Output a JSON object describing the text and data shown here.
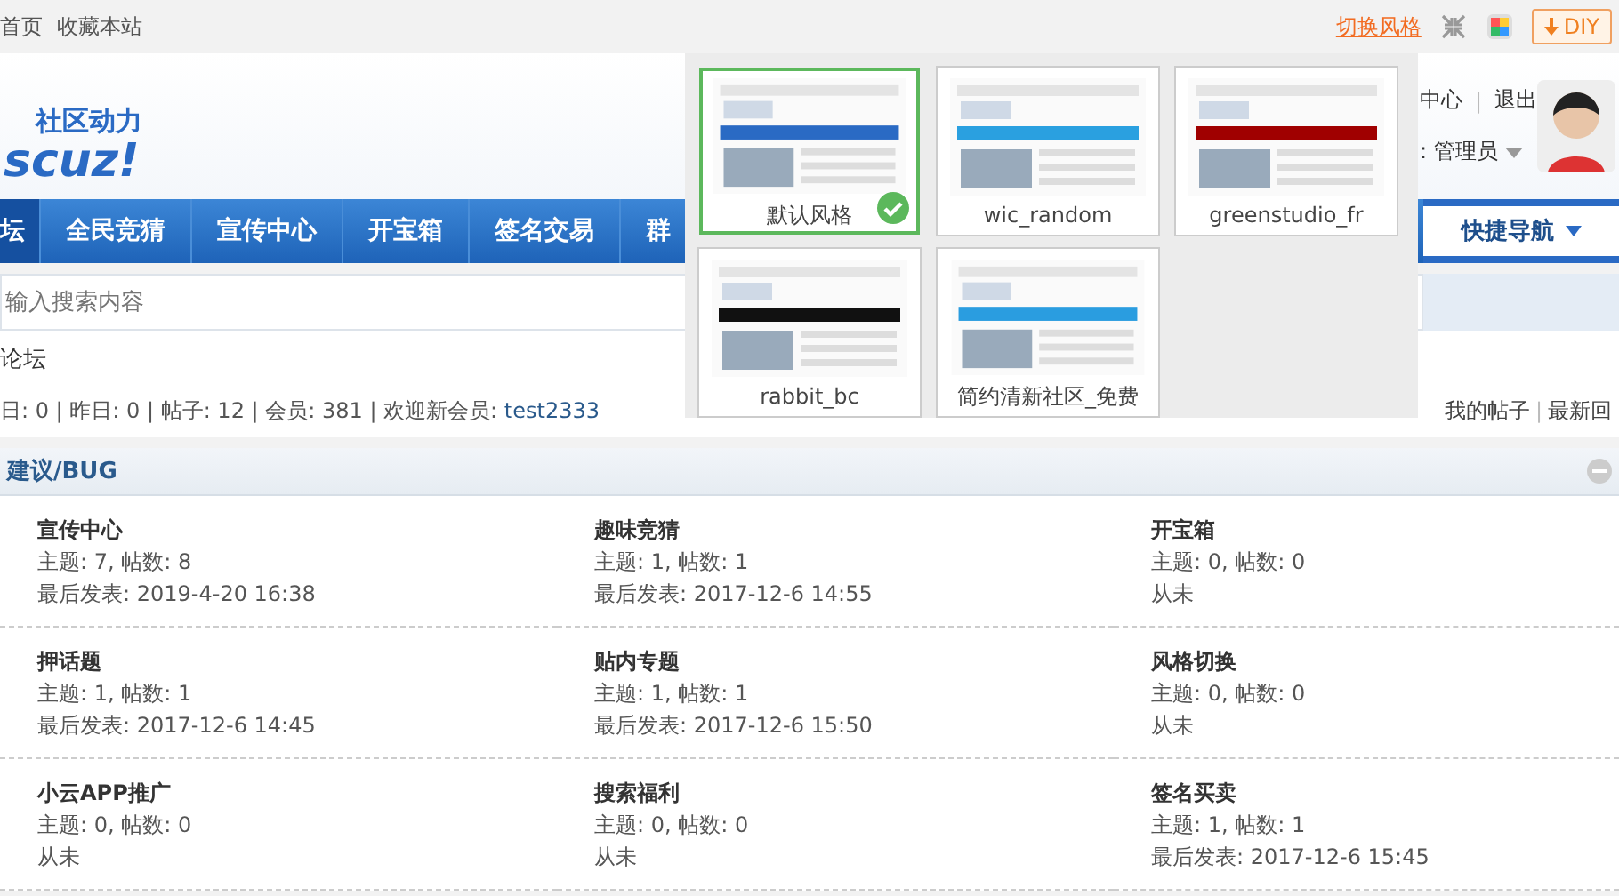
{
  "top_bar": {
    "links": [
      "首页",
      "收藏本站"
    ],
    "style_switch": "切换风格",
    "diy_button": "DIY"
  },
  "header": {
    "logo_tagline": "社区动力",
    "logo_text": "scuz!"
  },
  "separator": "|",
  "user_panel": {
    "links": [
      "中心",
      "退出"
    ],
    "group": ": 管理员"
  },
  "nav": [
    {
      "label": "坛",
      "selected": true
    },
    {
      "label": "全民竞猜",
      "selected": false
    },
    {
      "label": "宣传中心",
      "selected": false
    },
    {
      "label": "开宝箱",
      "selected": false
    },
    {
      "label": "签名交易",
      "selected": false
    },
    {
      "label": "群",
      "selected": false
    }
  ],
  "quick_nav": "快捷导航",
  "search": {
    "placeholder": "输入搜索内容"
  },
  "breadcrumb": "论坛",
  "stats": {
    "text": "日: 0 | 昨日: 0 | 帖子: 12 | 会员: 381 | 欢迎新会员: ",
    "new_member": "test2333"
  },
  "my_links": [
    "我的帖子",
    "最新回"
  ],
  "style_popup": {
    "themes": [
      {
        "name": "默认风格",
        "selected": true,
        "color": "#2a6ac4"
      },
      {
        "name": "wic_random",
        "selected": false,
        "color": "#2aa0e0"
      },
      {
        "name": "greenstudio_fr",
        "selected": false,
        "color": "#a00000"
      },
      {
        "name": "rabbit_bc",
        "selected": false,
        "color": "#111111"
      },
      {
        "name": "简约清新社区_免费",
        "selected": false,
        "color": "#2a9de0"
      }
    ]
  },
  "forum_section": {
    "title": "建议/BUG",
    "boards": [
      {
        "name": "宣传中心",
        "stats": "主题: 7, 帖数: 8",
        "last": "最后发表: 2019-4-20 16:38"
      },
      {
        "name": "趣味竞猜",
        "stats": "主题: 1, 帖数: 1",
        "last": "最后发表: 2017-12-6 14:55"
      },
      {
        "name": "开宝箱",
        "stats": "主题: 0, 帖数: 0",
        "last": "从未"
      },
      {
        "name": "押话题",
        "stats": "主题: 1, 帖数: 1",
        "last": "最后发表: 2017-12-6 14:45"
      },
      {
        "name": "贴内专题",
        "stats": "主题: 1, 帖数: 1",
        "last": "最后发表: 2017-12-6 15:50"
      },
      {
        "name": "风格切换",
        "stats": "主题: 0, 帖数: 0",
        "last": "从未"
      },
      {
        "name": "小云APP推广",
        "stats": "主题: 0, 帖数: 0",
        "last": "从未"
      },
      {
        "name": "搜索福利",
        "stats": "主题: 0, 帖数: 0",
        "last": "从未"
      },
      {
        "name": "签名买卖",
        "stats": "主题: 1, 帖数: 1",
        "last": "最后发表: 2017-12-6 15:45"
      }
    ]
  }
}
